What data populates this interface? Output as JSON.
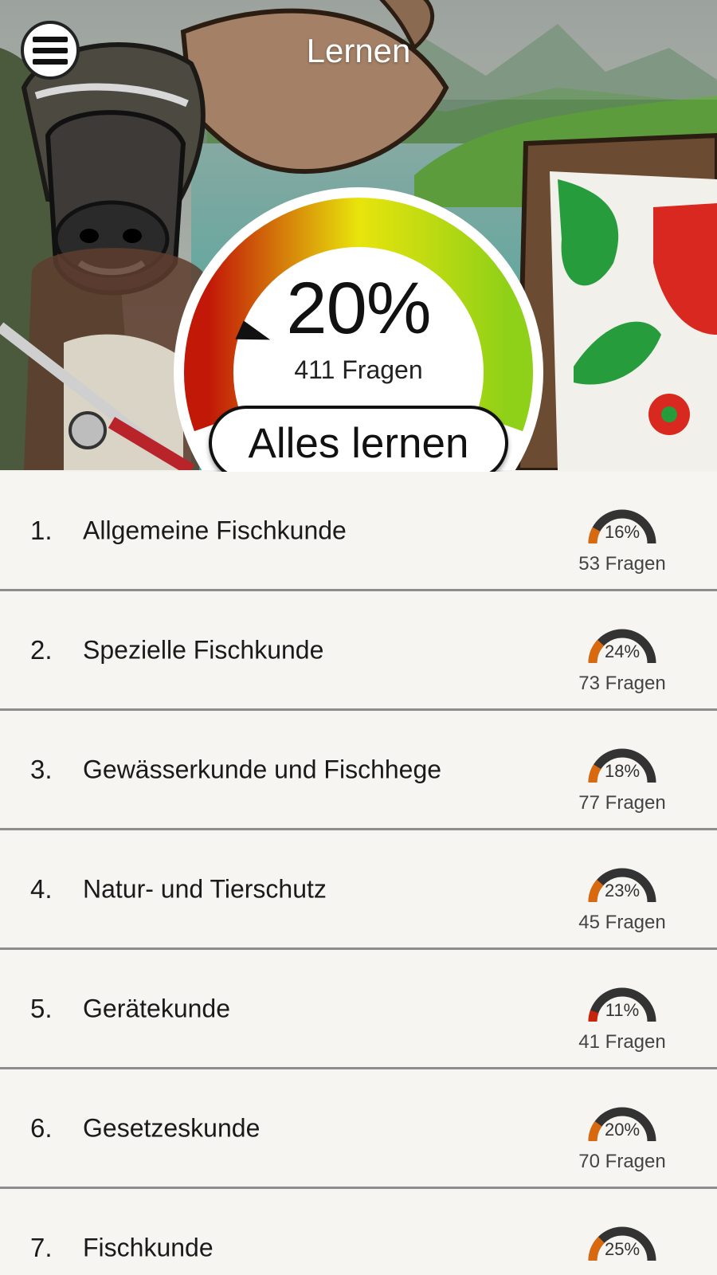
{
  "header": {
    "title": "Lernen",
    "menu_icon": "hamburger-menu-icon"
  },
  "overall": {
    "percent_label": "20%",
    "progress": 0.2,
    "questions_label": "411 Fragen",
    "learn_all_label": "Alles lernen"
  },
  "colors": {
    "gauge_low": "#c21808",
    "gauge_mid": "#e8e40c",
    "gauge_high": "#8fd018",
    "mini_track": "#333333",
    "list_bg": "#f6f5f2"
  },
  "topics": [
    {
      "number": "1.",
      "title": "Allgemeine Fischkunde",
      "percent_label": "16%",
      "progress": 0.16,
      "questions_label": "53 Fragen"
    },
    {
      "number": "2.",
      "title": "Spezielle Fischkunde",
      "percent_label": "24%",
      "progress": 0.24,
      "questions_label": "73 Fragen"
    },
    {
      "number": "3.",
      "title": "Gewässerkunde und Fischhege",
      "percent_label": "18%",
      "progress": 0.18,
      "questions_label": "77 Fragen"
    },
    {
      "number": "4.",
      "title": "Natur- und Tierschutz",
      "percent_label": "23%",
      "progress": 0.23,
      "questions_label": "45 Fragen"
    },
    {
      "number": "5.",
      "title": "Gerätekunde",
      "percent_label": "11%",
      "progress": 0.11,
      "questions_label": "41 Fragen"
    },
    {
      "number": "6.",
      "title": "Gesetzeskunde",
      "percent_label": "20%",
      "progress": 0.2,
      "questions_label": "70 Fragen"
    },
    {
      "number": "7.",
      "title": "Fischkunde",
      "percent_label": "25%",
      "progress": 0.25,
      "questions_label": ""
    }
  ]
}
